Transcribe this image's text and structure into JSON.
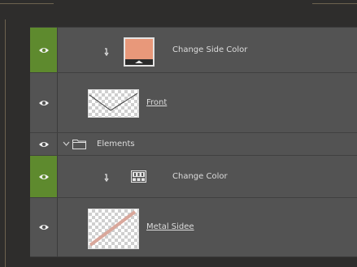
{
  "colors": {
    "panel_bg": "#474747",
    "row_bg": "#535353",
    "visible_active": "#5e8a2e",
    "swatch_fill": "#e8987a"
  },
  "layers": [
    {
      "name": "Change Side Color",
      "type": "solid-color-fill",
      "clipped": true,
      "eye_active": true
    },
    {
      "name": "Front",
      "type": "pixel",
      "clipped": false,
      "eye_active": false
    },
    {
      "name": "Elements",
      "type": "group",
      "expanded": true,
      "eye_active": false
    },
    {
      "name": "Change Color",
      "type": "gradient-map-adjustment",
      "clipped": true,
      "eye_active": true
    },
    {
      "name": "Metal Sidee",
      "type": "pixel",
      "clipped": false,
      "eye_active": false
    }
  ]
}
